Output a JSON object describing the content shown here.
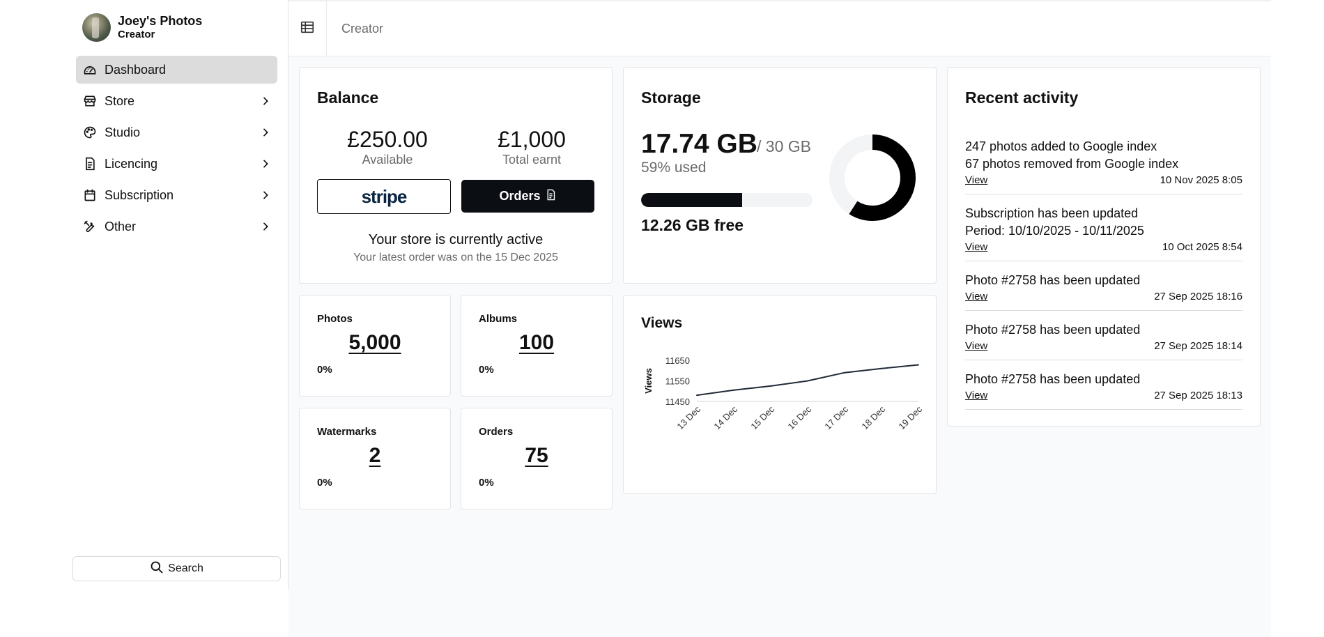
{
  "profile": {
    "name": "Joey's Photos",
    "role": "Creator"
  },
  "nav": [
    {
      "label": "Dashboard",
      "icon": "dashboard-icon",
      "active": true
    },
    {
      "label": "Store",
      "icon": "store-icon"
    },
    {
      "label": "Studio",
      "icon": "palette-icon"
    },
    {
      "label": "Licencing",
      "icon": "document-icon"
    },
    {
      "label": "Subscription",
      "icon": "calendar-icon"
    },
    {
      "label": "Other",
      "icon": "tools-icon"
    }
  ],
  "search": {
    "label": "Search"
  },
  "header": {
    "title": "Creator"
  },
  "balance": {
    "title": "Balance",
    "available_amount": "£250.00",
    "available_label": "Available",
    "earnt_amount": "£1,000",
    "earnt_label": "Total earnt",
    "stripe_label": "stripe",
    "orders_label": "Orders",
    "status": "Your store is currently active",
    "latest_order": "Your latest order was on the 15 Dec 2025"
  },
  "stats": [
    {
      "label": "Photos",
      "value": "5,000",
      "pct": "0%"
    },
    {
      "label": "Albums",
      "value": "100",
      "pct": "0%"
    },
    {
      "label": "Watermarks",
      "value": "2",
      "pct": "0%"
    },
    {
      "label": "Orders",
      "value": "75",
      "pct": "0%"
    }
  ],
  "storage": {
    "title": "Storage",
    "used": "17.74 GB",
    "total": "/ 30 GB",
    "pct_label": "59% used",
    "used_fraction": 0.59,
    "free": "12.26 GB free",
    "colors": {
      "fill": "#000000",
      "track": "#f3f4f6"
    }
  },
  "views": {
    "title": "Views",
    "chart_data": {
      "type": "line",
      "ylabel": "Views",
      "categories": [
        "13 Dec",
        "14 Dec",
        "15 Dec",
        "16 Dec",
        "17 Dec",
        "18 Dec",
        "19 Dec"
      ],
      "values": [
        11480,
        11505,
        11525,
        11550,
        11590,
        11610,
        11628
      ],
      "ylim": [
        11450,
        11650
      ],
      "yticks": [
        "11650",
        "11550",
        "11450"
      ],
      "line_color": "#1f2937"
    }
  },
  "activity": {
    "title": "Recent activity",
    "items": [
      {
        "lines": [
          "247 photos added to Google index",
          "67 photos removed from Google index"
        ],
        "view": "View",
        "time": "10 Nov 2025 8:05"
      },
      {
        "lines": [
          "Subscription has been updated",
          "Period: 10/10/2025 - 10/11/2025"
        ],
        "view": "View",
        "time": "10 Oct 2025 8:54"
      },
      {
        "lines": [
          "Photo #2758 has been updated"
        ],
        "view": "View",
        "time": "27 Sep 2025 18:16"
      },
      {
        "lines": [
          "Photo #2758 has been updated"
        ],
        "view": "View",
        "time": "27 Sep 2025 18:14"
      },
      {
        "lines": [
          "Photo #2758 has been updated"
        ],
        "view": "View",
        "time": "27 Sep 2025 18:13"
      }
    ]
  }
}
